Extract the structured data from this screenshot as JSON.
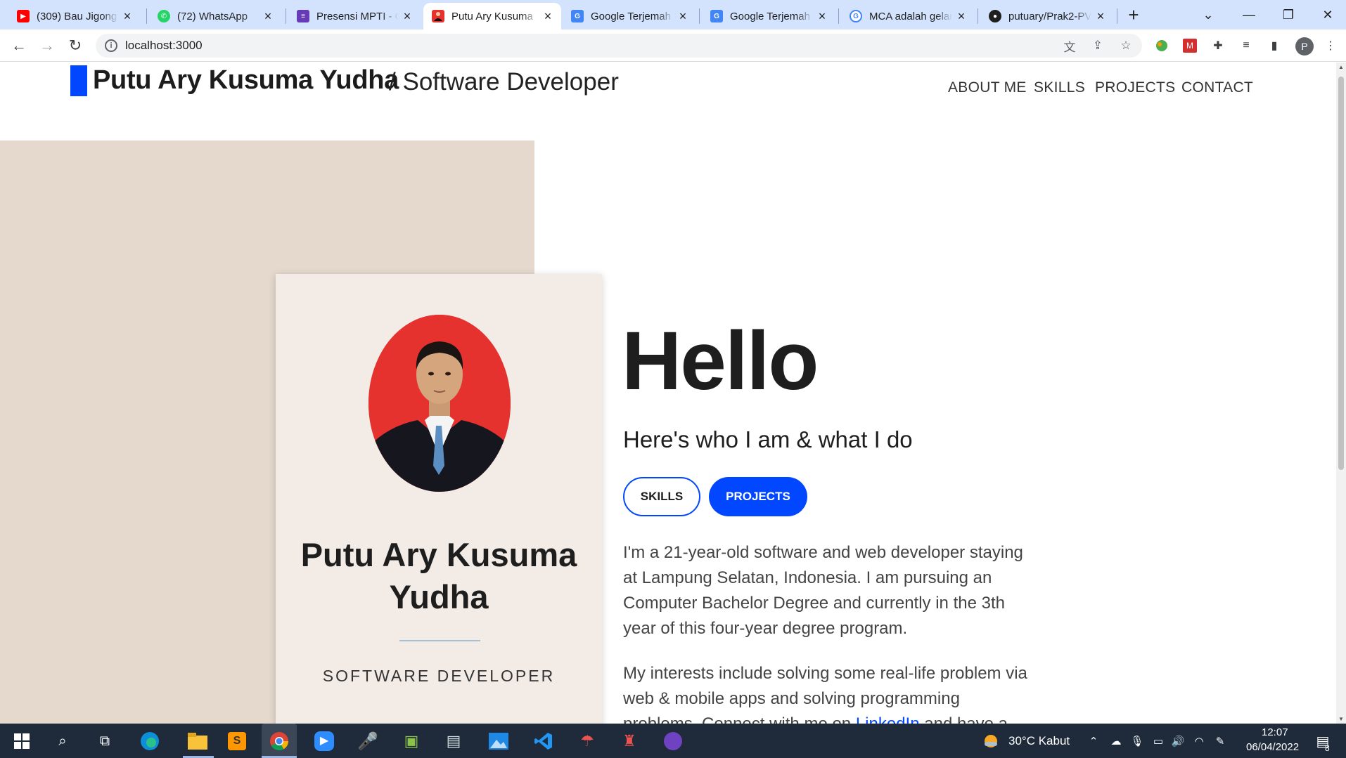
{
  "browser": {
    "tabs": [
      {
        "title": "(309) Bau Jigong",
        "favicon": "youtube-icon",
        "color": "#ff0000",
        "active": false
      },
      {
        "title": "(72) WhatsApp",
        "favicon": "whatsapp-icon",
        "color": "#25d366",
        "active": false
      },
      {
        "title": "Presensi MPTI - G",
        "favicon": "google-forms-icon",
        "color": "#673ab7",
        "active": false
      },
      {
        "title": "Putu Ary Kusuma",
        "favicon": "profile-photo-icon",
        "color": "#e5322e",
        "active": true
      },
      {
        "title": "Google Terjemah",
        "favicon": "google-translate-icon",
        "color": "#4285f4",
        "active": false
      },
      {
        "title": "Google Terjemah",
        "favicon": "google-translate-icon",
        "color": "#4285f4",
        "active": false
      },
      {
        "title": "MCA adalah gelar",
        "favicon": "google-icon",
        "color": "#4285f4",
        "active": false
      },
      {
        "title": "putuary/Prak2-PV",
        "favicon": "github-icon",
        "color": "#1f1f1f",
        "active": false
      }
    ],
    "url": "localhost:3000"
  },
  "page": {
    "brand": {
      "name": "Putu Ary Kusuma Yudha",
      "separator": "/",
      "role": "Software Developer"
    },
    "nav": [
      "ABOUT ME",
      "SKILLS",
      "PROJECTS",
      "CONTACT"
    ],
    "card": {
      "name": "Putu Ary Kusuma Yudha",
      "role": "SOFTWARE DEVELOPER"
    },
    "hero": {
      "title": "Hello",
      "subtitle": "Here's who I am & what I do",
      "btn_skills": "SKILLS",
      "btn_projects": "PROJECTS",
      "para1": "I'm a 21-year-old software and web developer staying at Lampung Selatan, Indonesia. I am pursuing an Computer Bachelor Degree and currently in the 3th year of this four-year degree program.",
      "para2_before": "My interests include solving some real-life problem via web & mobile apps and solving programming problems. Connect with me on ",
      "para2_link": "LinkedIn",
      "para2_after": " and have a"
    },
    "colors": {
      "accent": "#0047ff",
      "beige": "#e5d9ce",
      "card": "#f2ebe6",
      "avatar_bg": "#e5322e"
    }
  },
  "taskbar": {
    "weather": "30°C  Kabut",
    "time": "12:07",
    "date": "06/04/2022",
    "notifications": "8"
  }
}
